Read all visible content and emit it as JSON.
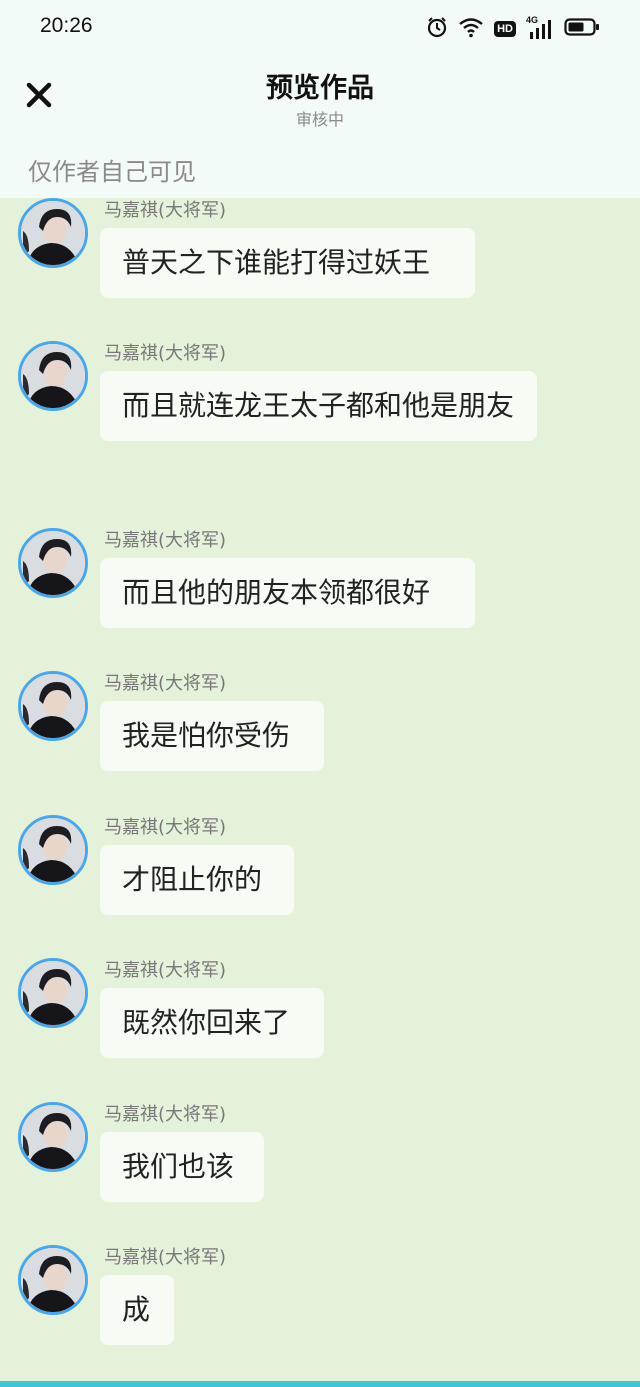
{
  "status_bar": {
    "time": "20:26",
    "icons": [
      "alarm-icon",
      "wifi-icon",
      "hd-icon",
      "4g-signal-icon",
      "battery-icon"
    ],
    "network_label": "4G",
    "hd_label": "HD"
  },
  "header": {
    "title": "预览作品",
    "subtitle": "审核中",
    "visibility_note": "仅作者自己可见"
  },
  "colors": {
    "chat_background": "#e4f2dc",
    "header_background": "#f2fbf7",
    "avatar_ring": "#4aa6e6",
    "bubble": "#f6fcf4"
  },
  "messages": [
    {
      "sender": "马嘉祺(大将军)",
      "text": "普天之下谁能打得过妖王"
    },
    {
      "sender": "马嘉祺(大将军)",
      "text": "而且就连龙王太子都和他是朋友"
    },
    {
      "sender": "马嘉祺(大将军)",
      "text": "而且他的朋友本领都很好"
    },
    {
      "sender": "马嘉祺(大将军)",
      "text": "我是怕你受伤"
    },
    {
      "sender": "马嘉祺(大将军)",
      "text": "才阻止你的"
    },
    {
      "sender": "马嘉祺(大将军)",
      "text": "既然你回来了"
    },
    {
      "sender": "马嘉祺(大将军)",
      "text": "我们也该"
    },
    {
      "sender": "马嘉祺(大将军)",
      "text": "成"
    }
  ]
}
